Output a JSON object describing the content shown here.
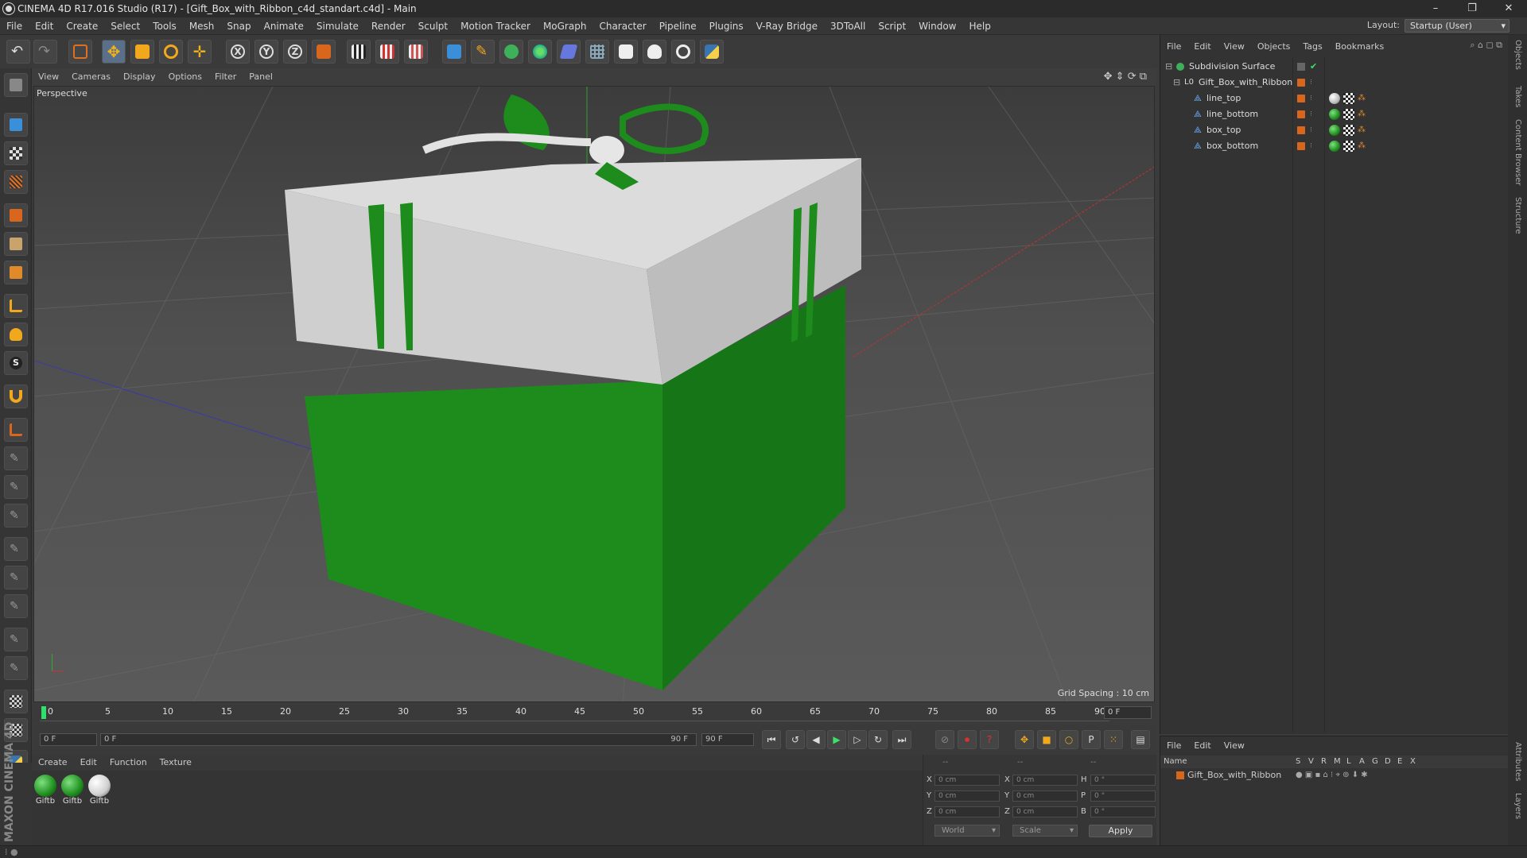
{
  "window": {
    "title": "CINEMA 4D R17.016 Studio (R17) - [Gift_Box_with_Ribbon_c4d_standart.c4d] - Main",
    "controls": [
      "–",
      "❐",
      "✕"
    ]
  },
  "menubar": [
    "File",
    "Edit",
    "Create",
    "Select",
    "Tools",
    "Mesh",
    "Snap",
    "Animate",
    "Simulate",
    "Render",
    "Sculpt",
    "Motion Tracker",
    "MoGraph",
    "Character",
    "Pipeline",
    "Plugins",
    "V-Ray Bridge",
    "3DToAll",
    "Script",
    "Window",
    "Help"
  ],
  "layout": {
    "label": "Layout:",
    "value": "Startup (User)"
  },
  "viewport": {
    "menu": [
      "View",
      "Cameras",
      "Display",
      "Options",
      "Filter",
      "Panel"
    ],
    "label": "Perspective",
    "grid_spacing": "Grid Spacing : 10 cm"
  },
  "timeline": {
    "ticks": [
      "0",
      "5",
      "10",
      "15",
      "20",
      "25",
      "30",
      "35",
      "40",
      "45",
      "50",
      "55",
      "60",
      "65",
      "70",
      "75",
      "80",
      "85",
      "90"
    ],
    "current_frame": "0 F"
  },
  "transport": {
    "start_field": "0 F",
    "range_start": "0 F",
    "range_end": "90 F",
    "end_field": "90 F"
  },
  "materials": {
    "menu": [
      "Create",
      "Edit",
      "Function",
      "Texture"
    ],
    "items": [
      {
        "label": "Giftb",
        "color": "#1f8f1f"
      },
      {
        "label": "Giftb",
        "color": "#1f8f1f"
      },
      {
        "label": "Giftb",
        "color": "#d8d8d8"
      }
    ]
  },
  "brand": {
    "name": "MAXON CINEMA 4D"
  },
  "coords": {
    "header": [
      "--",
      "--",
      "--"
    ],
    "pos_labels": [
      "X",
      "Y",
      "Z"
    ],
    "pos_values": [
      "0 cm",
      "0 cm",
      "0 cm"
    ],
    "size_labels": [
      "X",
      "Y",
      "Z"
    ],
    "size_values": [
      "0 cm",
      "0 cm",
      "0 cm"
    ],
    "rot_labels": [
      "H",
      "P",
      "B"
    ],
    "rot_values": [
      "0 °",
      "0 °",
      "0 °"
    ],
    "space": "World",
    "mode": "Scale",
    "apply": "Apply"
  },
  "objects": {
    "menu": [
      "File",
      "Edit",
      "View",
      "Objects",
      "Tags",
      "Bookmarks"
    ],
    "items": [
      {
        "name": "Subdivision Surface",
        "level": 0
      },
      {
        "name": "Gift_Box_with_Ribbon",
        "level": 1
      },
      {
        "name": "line_top",
        "level": 2
      },
      {
        "name": "line_bottom",
        "level": 2
      },
      {
        "name": "box_top",
        "level": 2
      },
      {
        "name": "box_bottom",
        "level": 2
      }
    ]
  },
  "layers": {
    "menu": [
      "File",
      "Edit",
      "View"
    ],
    "head_name": "Name",
    "head_cols": [
      "S",
      "V",
      "R",
      "M",
      "L",
      "A",
      "G",
      "D",
      "E",
      "X"
    ],
    "items": [
      {
        "name": "Gift_Box_with_Ribbon"
      }
    ]
  },
  "side_tabs": [
    "Objects",
    "Takes",
    "Content Browser",
    "Structure",
    "Attributes",
    "Layers"
  ]
}
